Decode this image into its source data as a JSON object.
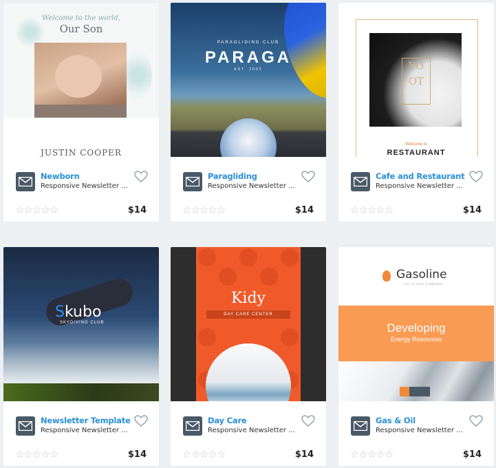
{
  "cards": [
    {
      "title": "Newborn",
      "subtitle": "Responsive Newsletter ...",
      "price": "$14",
      "stars": "☆☆☆☆☆",
      "preview": {
        "welcome": "Welcome to the world,",
        "name": "Our Son",
        "footer": "JUSTIN COOPER"
      }
    },
    {
      "title": "Paragliding",
      "subtitle": "Responsive Newsletter ...",
      "price": "$14",
      "stars": "☆☆☆☆☆",
      "preview": {
        "club": "PARAGLIDING CLUB",
        "word": "PARAGA",
        "est": "EST. 2002"
      }
    },
    {
      "title": "Cafe and Restaurant",
      "subtitle": "Responsive Newsletter ...",
      "price": "$14",
      "stars": "☆☆☆☆☆",
      "preview": {
        "logo": "YO OT",
        "welcome": "Welcome to",
        "heading": "RESTAURANT"
      }
    },
    {
      "title": "Newsletter Template",
      "subtitle": "Responsive Newsletter ...",
      "price": "$14",
      "stars": "☆☆☆☆☆",
      "preview": {
        "brand_s": "S",
        "brand_rest": "kubo",
        "sub": "SKYDIVING CLUB"
      }
    },
    {
      "title": "Day Care",
      "subtitle": "Responsive Newsletter ...",
      "price": "$14",
      "stars": "☆☆☆☆☆",
      "preview": {
        "name": "Kidy",
        "band": "DAY CARE CENTER"
      }
    },
    {
      "title": "Gas & Oil",
      "subtitle": "Responsive Newsletter ...",
      "price": "$14",
      "stars": "☆☆☆☆☆",
      "preview": {
        "logo": "Gasoline",
        "tag": "OIL & GAS COMPANY",
        "hero": "Developing",
        "hero_sub": "Energy Resources"
      }
    }
  ],
  "colors": {
    "title": "#2a8fd8",
    "icon_bg": "#4a5968",
    "background": "#edf0f3"
  },
  "icons": {
    "template": "envelope-icon",
    "favorite": "heart-icon",
    "rating": "star-icon"
  }
}
